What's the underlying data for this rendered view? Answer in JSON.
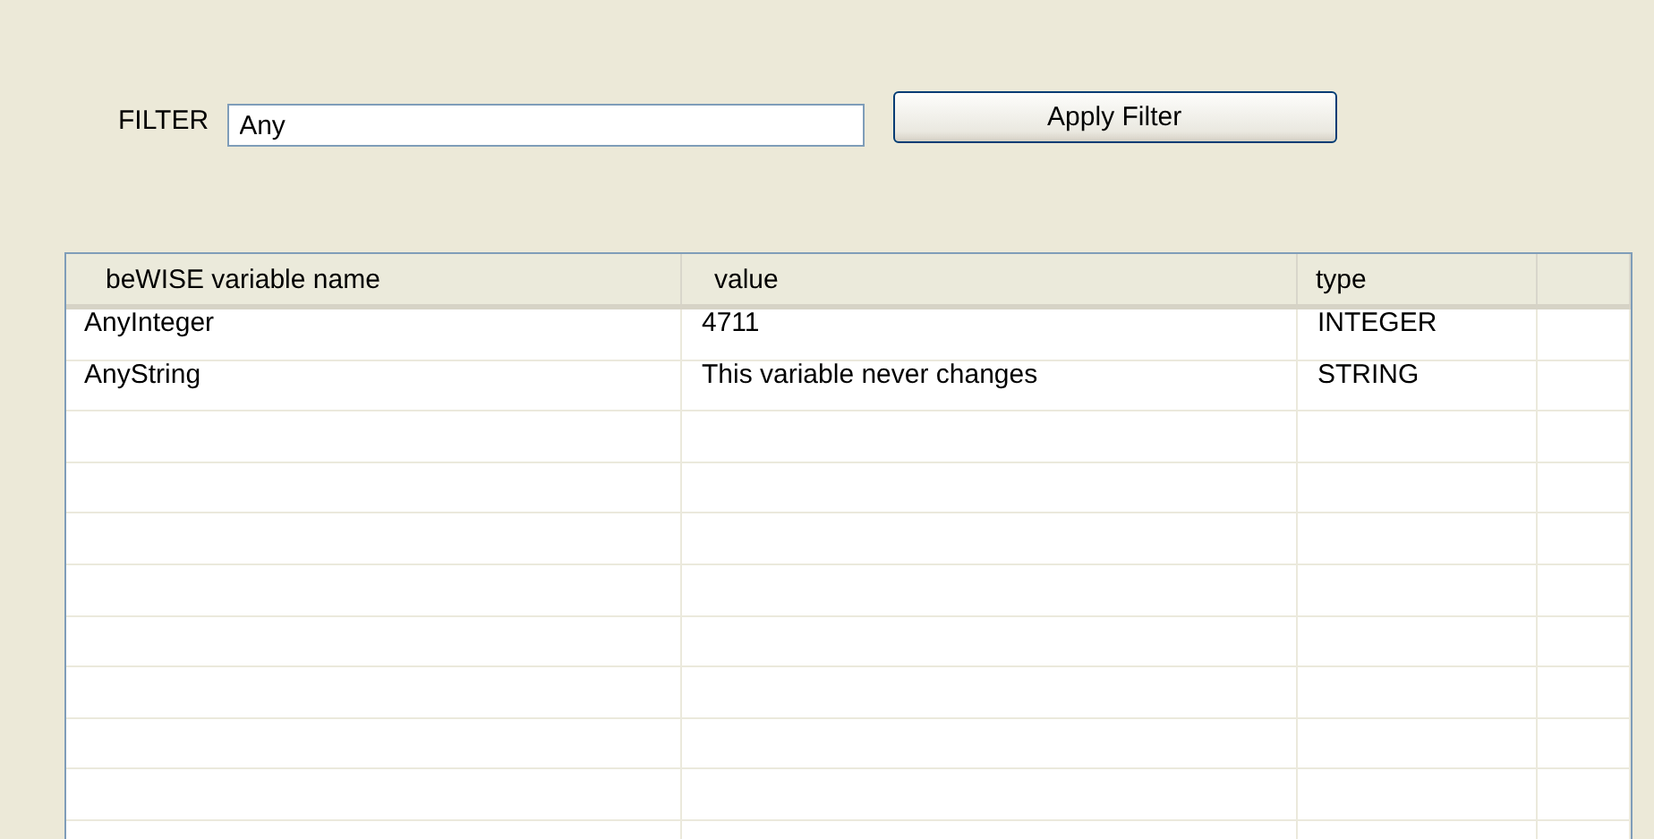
{
  "filter": {
    "label": "FILTER",
    "value": "Any",
    "button": "Apply Filter"
  },
  "table": {
    "columns": [
      "beWISE variable name",
      "value",
      "type"
    ],
    "rows": [
      [
        "AnyInteger",
        "4711",
        "INTEGER"
      ],
      [
        "AnyString",
        "This variable never changes",
        "STRING"
      ]
    ]
  }
}
